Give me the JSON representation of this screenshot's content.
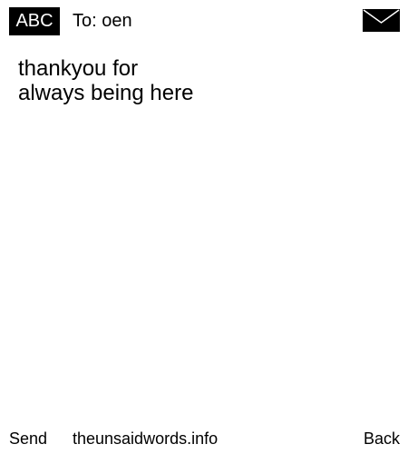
{
  "header": {
    "input_mode": "ABC",
    "recipient": "To: oen",
    "envelope_icon": "envelope-icon"
  },
  "message": {
    "text": "thankyou for\nalways being here"
  },
  "footer": {
    "send_label": "Send",
    "site_label": "theunsaidwords.info",
    "back_label": "Back"
  },
  "colors": {
    "background": "#ffffff",
    "foreground": "#000000"
  }
}
